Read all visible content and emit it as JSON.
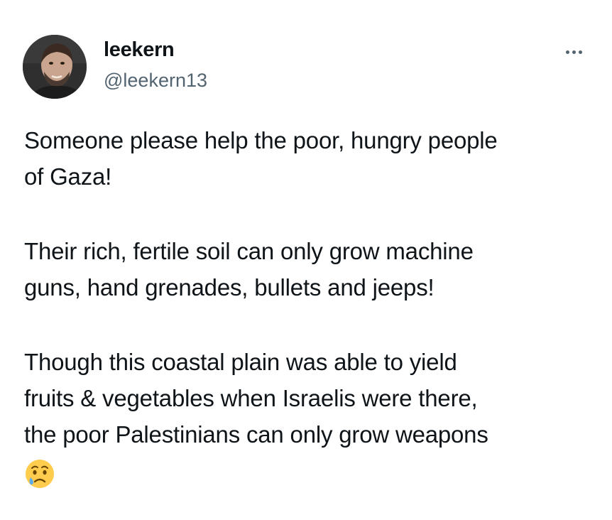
{
  "post": {
    "author": {
      "display_name": "leekern",
      "handle": "@leekern13",
      "avatar_icon": "avatar-photo"
    },
    "more_icon": "more-dots-icon",
    "paragraphs": [
      {
        "lines": [
          "Someone please help the poor, hungry people",
          "of Gaza!"
        ]
      },
      {
        "lines": [
          "Their rich, fertile soil can only grow machine",
          "guns, hand grenades, bullets and jeeps!"
        ]
      },
      {
        "lines": [
          "Though this coastal plain was able to yield",
          "fruits & vegetables when Israelis were there,",
          "the poor Palestinians can only grow weapons"
        ]
      }
    ],
    "trailing_emoji": "crying-face-emoji"
  },
  "colors": {
    "text": "#0f1419",
    "secondary_text": "#536471",
    "background": "#ffffff"
  }
}
